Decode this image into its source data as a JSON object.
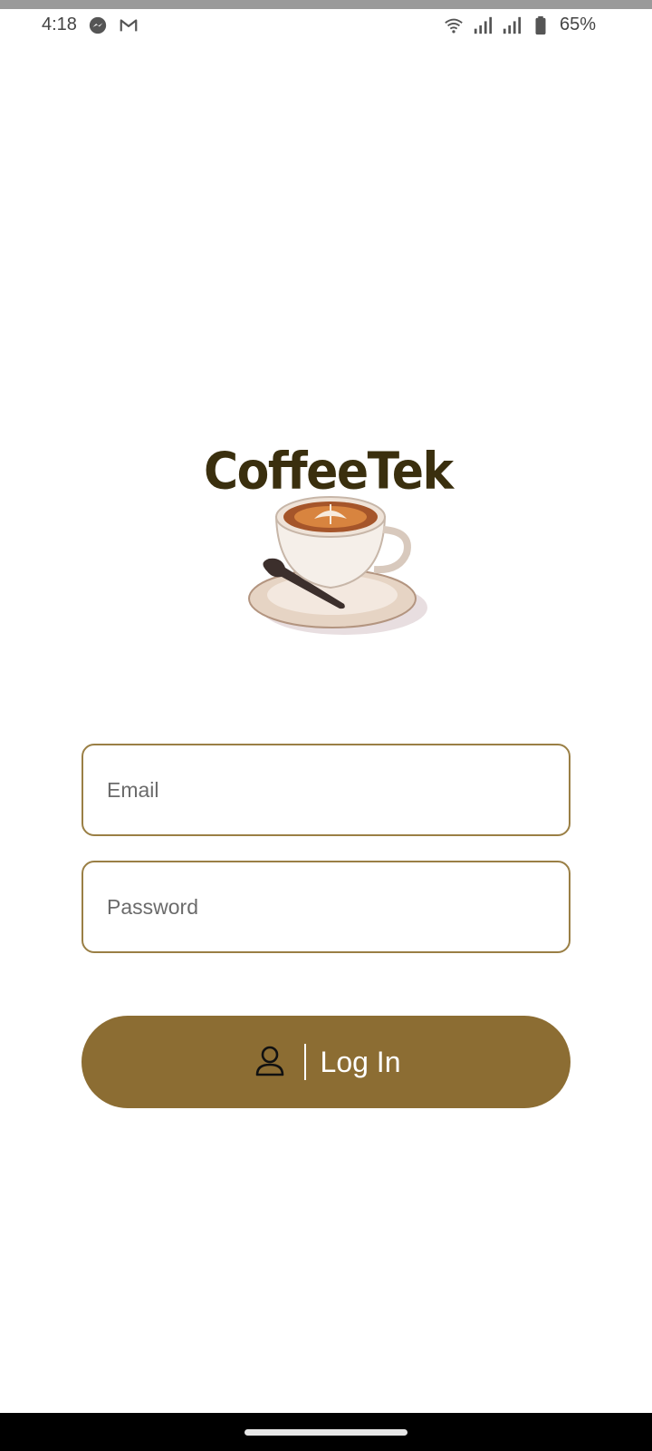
{
  "status_bar": {
    "time": "4:18",
    "battery_percent": "65%",
    "icons": [
      "messenger-icon",
      "gmail-icon",
      "wifi-icon",
      "signal-icon",
      "signal-icon",
      "battery-icon"
    ]
  },
  "logo": {
    "text": "CoffeeTek",
    "image": "coffee-cup-with-latte-art"
  },
  "form": {
    "email_placeholder": "Email",
    "email_value": "",
    "password_placeholder": "Password",
    "password_value": ""
  },
  "login_button": {
    "label": "Log In",
    "icon": "user-icon"
  },
  "colors": {
    "accent": "#8c6d33",
    "field_border": "#9a7f45",
    "logo_text": "#3a2f0e"
  }
}
